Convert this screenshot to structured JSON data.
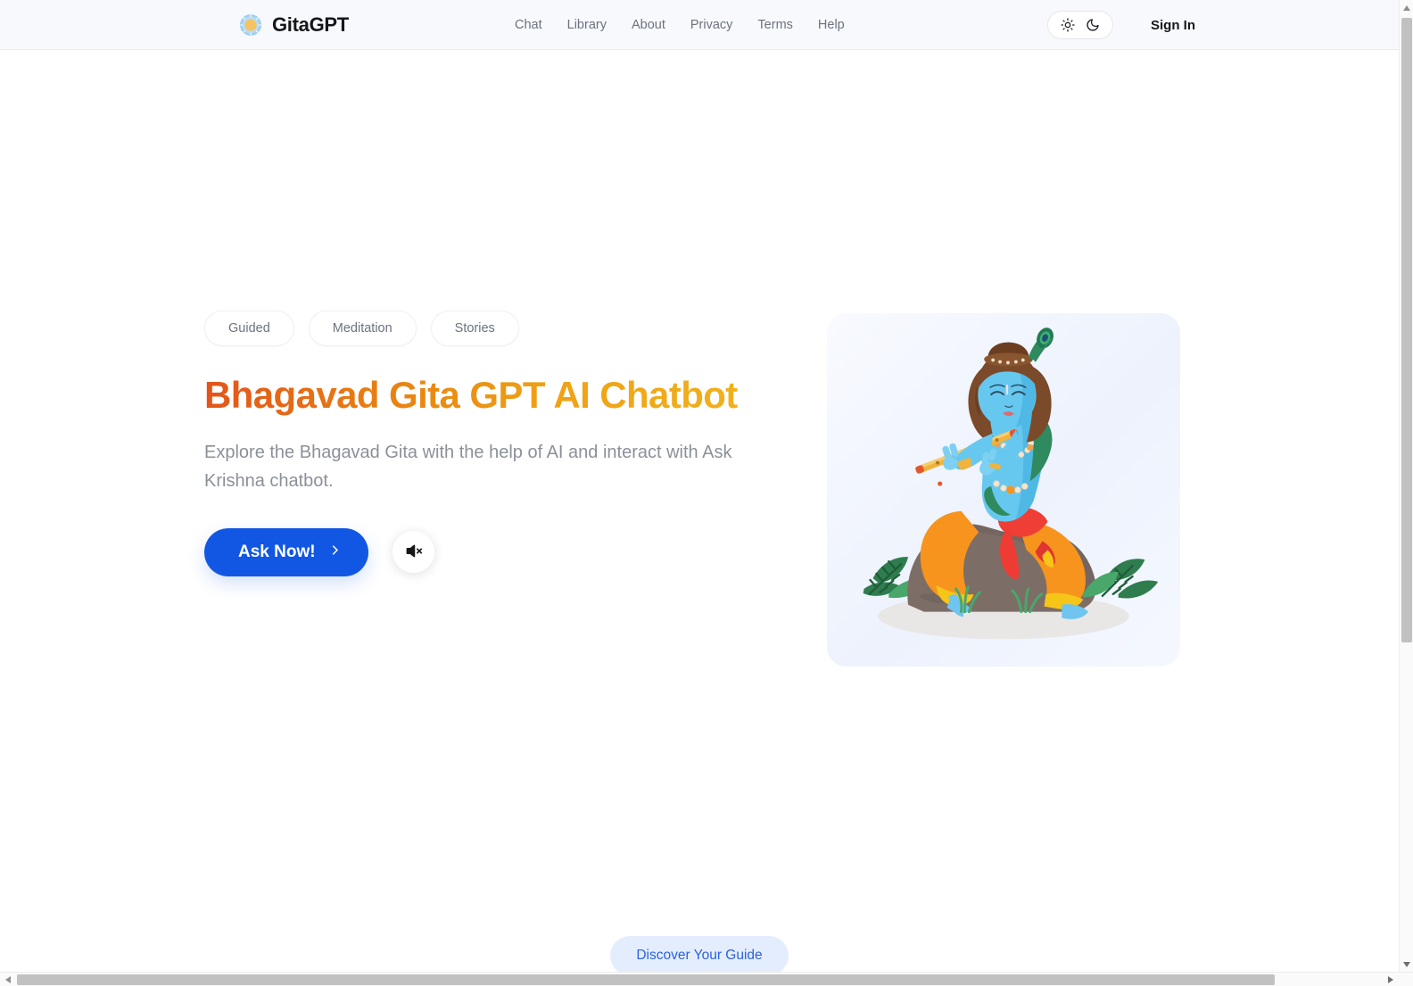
{
  "header": {
    "brand": {
      "name": "GitaGPT",
      "logo_icon": "sun-circle-logo-icon"
    },
    "nav": [
      {
        "label": "Chat",
        "name": "nav-link-chat"
      },
      {
        "label": "Library",
        "name": "nav-link-library"
      },
      {
        "label": "About",
        "name": "nav-link-about"
      },
      {
        "label": "Privacy",
        "name": "nav-link-privacy"
      },
      {
        "label": "Terms",
        "name": "nav-link-terms"
      },
      {
        "label": "Help",
        "name": "nav-link-help"
      }
    ],
    "theme_toggle": {
      "light_icon": "sun-icon",
      "dark_icon": "moon-icon"
    },
    "sign_in_label": "Sign In"
  },
  "hero": {
    "tags": [
      "Guided",
      "Meditation",
      "Stories"
    ],
    "headline": "Bhagavad Gita GPT AI Chatbot",
    "subhead": "Explore the Bhagavad Gita with the help of AI and interact with Ask Krishna chatbot.",
    "cta_label": "Ask Now!",
    "cta_chevron_icon": "chevron-right-icon",
    "mute_icon": "speaker-mute-icon",
    "illustration_alt": "krishna-playing-flute-illustration"
  },
  "bottom": {
    "discover_label": "Discover Your Guide"
  },
  "colors": {
    "header_bg": "#f8f9fc",
    "headline_gradient_start": "#e2541b",
    "headline_gradient_end": "#f0b51f",
    "primary_button": "#1157e3",
    "soft_button_bg": "#e4edfd",
    "soft_button_text": "#2a62e0",
    "muted_text": "#8b9099",
    "page_bg": "#ffffff"
  },
  "scrollbars": {
    "vertical": {
      "up_icon": "caret-up-icon",
      "down_icon": "caret-down-icon"
    },
    "horizontal": {
      "left_icon": "caret-left-icon",
      "right_icon": "caret-right-icon"
    }
  }
}
